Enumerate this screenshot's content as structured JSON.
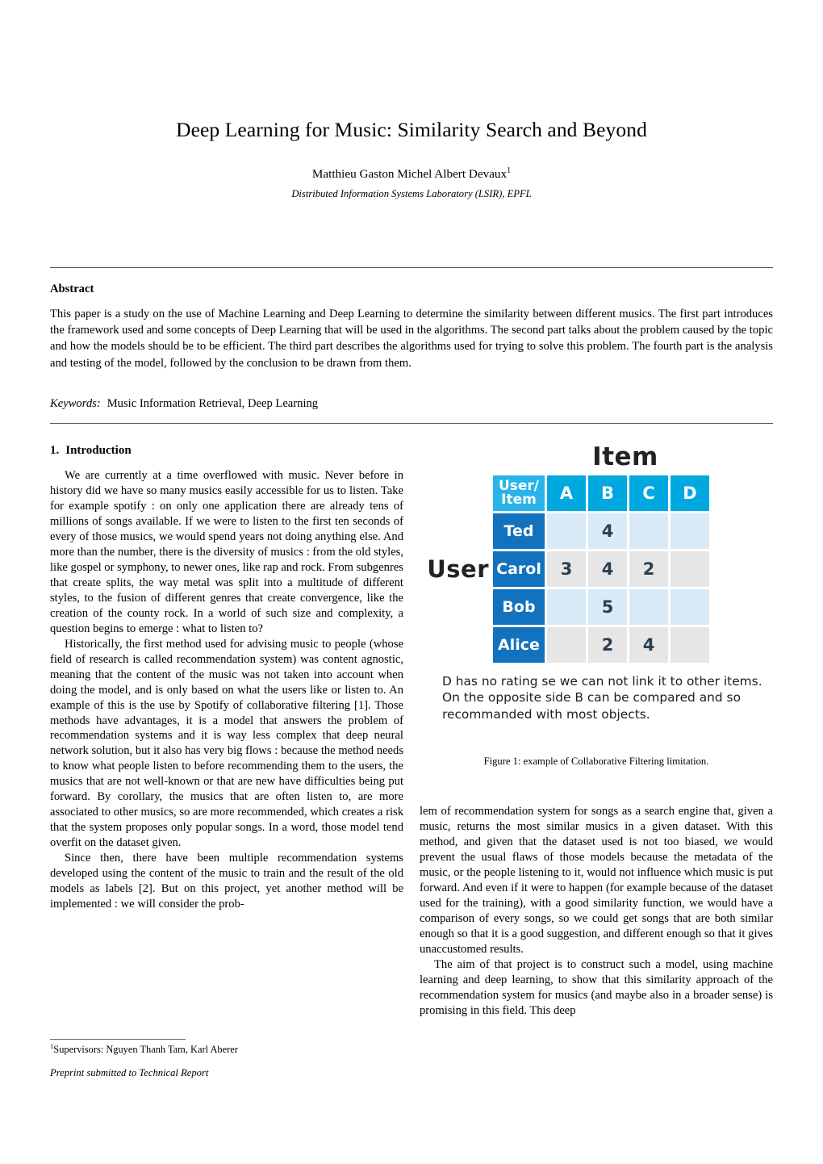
{
  "paper": {
    "title": "Deep Learning for Music: Similarity Search and Beyond",
    "author": "Matthieu Gaston Michel Albert Devaux",
    "author_footnote_marker": "1",
    "affiliation": "Distributed Information Systems Laboratory (LSIR), EPFL"
  },
  "abstract": {
    "heading": "Abstract",
    "body": "This paper is a study on the use of Machine Learning and Deep Learning to determine the similarity between different musics. The first part introduces the framework used and some concepts of Deep Learning that will be used in the algorithms. The second part talks about the problem caused by the topic and how the models should be to be efficient. The third part describes the algorithms used for trying to solve this problem. The fourth part is the analysis and testing of the model, followed by the conclusion to be drawn from them.",
    "keywords_label": "Keywords:",
    "keywords_list": "Music Information Retrieval, Deep Learning"
  },
  "section": {
    "number": "1.",
    "title": "Introduction"
  },
  "body": {
    "left_paragraphs": [
      "We are currently at a time overflowed with music. Never before in history did we have so many musics easily accessible for us to listen. Take for example spotify : on only one application there are already tens of millions of songs available. If we were to listen to the first ten seconds of every of those musics, we would spend years not doing anything else. And more than the number, there is the diversity of musics : from the old styles, like gospel or symphony, to newer ones, like rap and rock. From subgenres that create splits, the way metal was split into a multitude of different styles, to the fusion of different genres that create convergence, like the creation of the county rock. In a world of such size and complexity, a question begins to emerge : what to listen to?",
      "Historically, the first method used for advising music to people (whose field of research is called recommendation system) was content agnostic, meaning that the content of the music was not taken into account when doing the model, and is only based on what the users like or listen to. An example of this is the use by Spotify of collaborative filtering [1]. Those methods have advantages, it is a model that answers the problem of recommendation systems and it is way less complex that deep neural network solution, but it also has very big flows : because the method needs to know what people listen to before recommending them to the users, the musics that are not well-known or that are new have difficulties being put forward. By corollary, the musics that are often listen to, are more associated to other musics, so are more recommended, which creates a risk that the system proposes only popular songs. In a word, those model tend overfit on the dataset given.",
      "Since then, there have been multiple recommendation systems developed using the content of the music to train and the result of the old models as labels [2]. But on this project, yet another method will be implemented : we will consider the prob-"
    ],
    "right_paragraphs": [
      "lem of recommendation system for songs as a search engine that, given a music, returns the most similar musics in a given dataset. With this method, and given that the dataset used is not too biased, we would prevent the usual flaws of those models because the metadata of the music, or the people listening to it, would not influence which music is put forward. And even if it were to happen (for example because of the dataset used for the training), with a good similarity function, we would have a comparison of every songs, so we could get songs that are both similar enough so that it is a good suggestion, and different enough so that it gives unaccustomed results.",
      "The aim of that project is to construct such a model, using machine learning and deep learning, to show that this similarity approach of the recommendation system for musics (and maybe also in a broader sense) is promising in this field. This deep"
    ]
  },
  "figure": {
    "axis_label_top": "Item",
    "axis_label_left": "User",
    "corner_line1": "User/",
    "corner_line2": "Item",
    "columns": [
      "A",
      "B",
      "C",
      "D"
    ],
    "rows": [
      {
        "name": "Ted",
        "values": [
          "",
          "4",
          "",
          ""
        ],
        "shade": "blue"
      },
      {
        "name": "Carol",
        "values": [
          "3",
          "4",
          "2",
          ""
        ],
        "shade": "gray"
      },
      {
        "name": "Bob",
        "values": [
          "",
          "5",
          "",
          ""
        ],
        "shade": "blue"
      },
      {
        "name": "Alice",
        "values": [
          "",
          "2",
          "4",
          ""
        ],
        "shade": "gray"
      }
    ],
    "note": "D has no rating se we can not link it to other items. On the opposite side B can be compared and so recommanded with most objects.",
    "caption": "Figure 1: example of Collaborative Filtering limitation.",
    "colors": {
      "column_header": "#00a8e0",
      "corner_header": "#29b4e8",
      "row_header": "#1272bd",
      "cell_blue": "#d9eaf8",
      "cell_gray": "#e6e6e6"
    }
  },
  "footer": {
    "footnote_marker": "1",
    "footnote_text": "Supervisors: Nguyen Thanh Tam, Karl Aberer",
    "preprint_line": "Preprint submitted to Technical Report"
  }
}
